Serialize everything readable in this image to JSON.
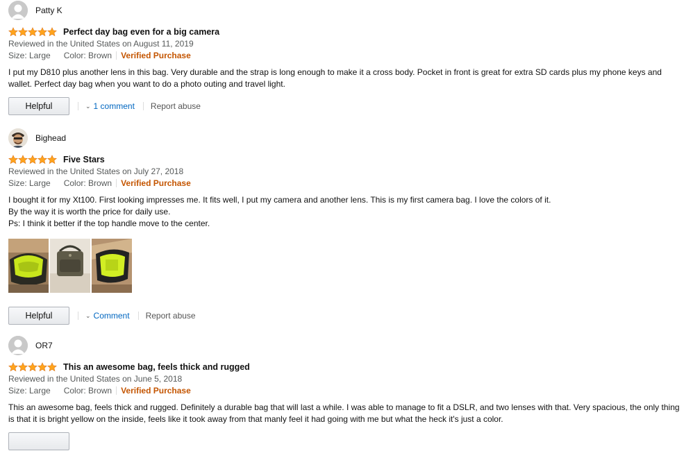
{
  "reviews": [
    {
      "name": "Patty K",
      "title": "Perfect day bag even for a big camera",
      "reviewed": "Reviewed in the United States on August 11, 2019",
      "size": "Size: Large",
      "color": "Color: Brown",
      "verified": "Verified Purchase",
      "body": "I put my D810 plus another lens in this bag. Very durable and the strap is long enough to make it a cross body. Pocket in front is great for extra SD cards plus my phone keys and wallet. Perfect day bag when you want to do a photo outing and travel light.",
      "helpful": "Helpful",
      "comment": "1 comment",
      "report": "Report abuse",
      "rating": 5
    },
    {
      "name": "Bighead",
      "title": "Five Stars",
      "reviewed": "Reviewed in the United States on July 27, 2018",
      "size": "Size: Large",
      "color": "Color: Brown",
      "verified": "Verified Purchase",
      "body_lines": [
        "I bought it for my Xt100. First looking impresses me. It fits well, I put my camera and another lens. This is my first camera bag. I love the colors of it.",
        "By the way it is worth the price for daily use.",
        "Ps: I think it better if the top handle move to the center."
      ],
      "helpful": "Helpful",
      "comment": "Comment",
      "report": "Report abuse",
      "rating": 5
    },
    {
      "name": "OR7",
      "title": "This an awesome bag, feels thick and rugged",
      "reviewed": "Reviewed in the United States on June 5, 2018",
      "size": "Size: Large",
      "color": "Color: Brown",
      "verified": "Verified Purchase",
      "body": "This an awesome bag, feels thick and rugged. Definitely a durable bag that will last a while. I was able to manage to fit a DSLR, and two lenses with that. Very spacious, the only thing is that it is bright yellow on the inside, feels like it took away from that manly feel it had going with me but what the heck it's just a color.",
      "rating": 5
    }
  ],
  "colors": {
    "star": "#ffa41c",
    "verified": "#c45500",
    "link": "#0066c0"
  }
}
